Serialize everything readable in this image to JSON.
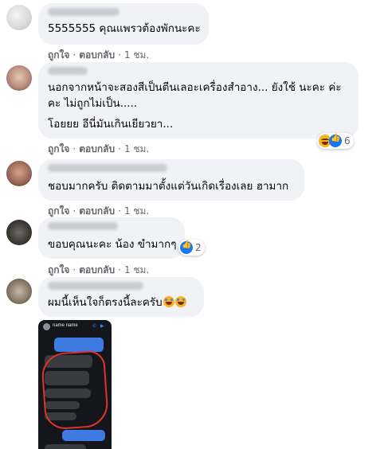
{
  "comments": [
    {
      "text_lines": [
        "5555555 คุณแพรวต้องพักนะคะ"
      ],
      "like": "ถูกใจ",
      "sep1": "·",
      "reply": "ตอบกลับ",
      "sep2": "·",
      "time": "1 ชม."
    },
    {
      "text_lines": [
        "นอกจากหน้าจะสองสีเป็นตีนเลอะเครื่องสำอาง... ยังใช้ นะคะ ค่ะ",
        "คะ ไม่ถูกไม่เป็น.....",
        "โอยยย อีนี่มันเกินเยียวยา..."
      ],
      "like": "ถูกใจ",
      "sep1": "·",
      "reply": "ตอบกลับ",
      "sep2": "·",
      "time": "1 ชม.",
      "reactions": {
        "icons": [
          "laugh-icon",
          "thumbs-up-icon"
        ],
        "count": "6"
      }
    },
    {
      "text_lines": [
        "ชอบมากครับ ติดตามมาตั้งแต่วันเกิดเรื่องเลย ฮามาก"
      ],
      "like": "ถูกใจ",
      "sep1": "·",
      "reply": "ตอบกลับ",
      "sep2": "·",
      "time": "1 ชม."
    },
    {
      "text_lines": [
        "ขอบคุณนะคะ น้อง ขำมากๆ"
      ],
      "like": "ถูกใจ",
      "sep1": "·",
      "reply": "ตอบกลับ",
      "sep2": "·",
      "time": "1 ชม.",
      "reactions": {
        "icons": [
          "thumbs-up-icon"
        ],
        "count": "2"
      }
    },
    {
      "text_lines": [
        "ผมนี้เห็นใจก็ตรงนี้ละครับ"
      ],
      "emoji": [
        "laugh-cry-icon",
        "laugh-cry-icon"
      ]
    }
  ],
  "attachment": {
    "header_name": "name name",
    "icons": [
      "phone-icon",
      "video-icon"
    ]
  },
  "colors": {
    "bubble": "#f0f2f5",
    "meta": "#65676b",
    "like_blue": "#1877f2",
    "circle": "#e0322b"
  }
}
